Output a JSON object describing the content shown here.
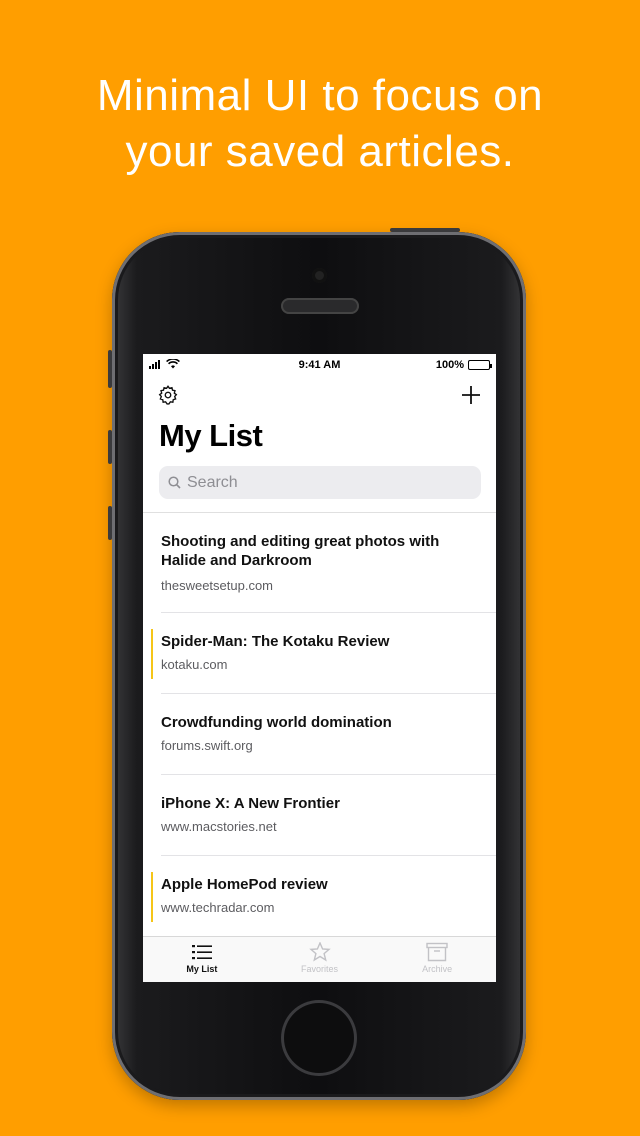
{
  "headline": {
    "line1": "Minimal UI to focus on",
    "line2": "your saved articles."
  },
  "status_bar": {
    "time": "9:41 AM",
    "battery": "100%"
  },
  "nav": {
    "settings_icon": "gear-icon",
    "add_icon": "plus-icon"
  },
  "page": {
    "title": "My List"
  },
  "search": {
    "placeholder": "Search",
    "value": ""
  },
  "articles": [
    {
      "title": "Shooting and editing great photos with Halide and Darkroom",
      "source": "thesweetsetup.com",
      "marked": false
    },
    {
      "title": "Spider-Man: The Kotaku Review",
      "source": "kotaku.com",
      "marked": true
    },
    {
      "title": "Crowdfunding world domination",
      "source": "forums.swift.org",
      "marked": false
    },
    {
      "title": "iPhone X: A New Frontier",
      "source": "www.macstories.net",
      "marked": false
    },
    {
      "title": "Apple HomePod review",
      "source": "www.techradar.com",
      "marked": true
    }
  ],
  "tabbar": {
    "tabs": [
      {
        "label": "My List",
        "icon": "list-icon",
        "active": true
      },
      {
        "label": "Favorites",
        "icon": "star-icon",
        "active": false
      },
      {
        "label": "Archive",
        "icon": "archive-box-icon",
        "active": false
      }
    ]
  },
  "colors": {
    "background": "#FF9E00",
    "marker": "#F5C518"
  }
}
